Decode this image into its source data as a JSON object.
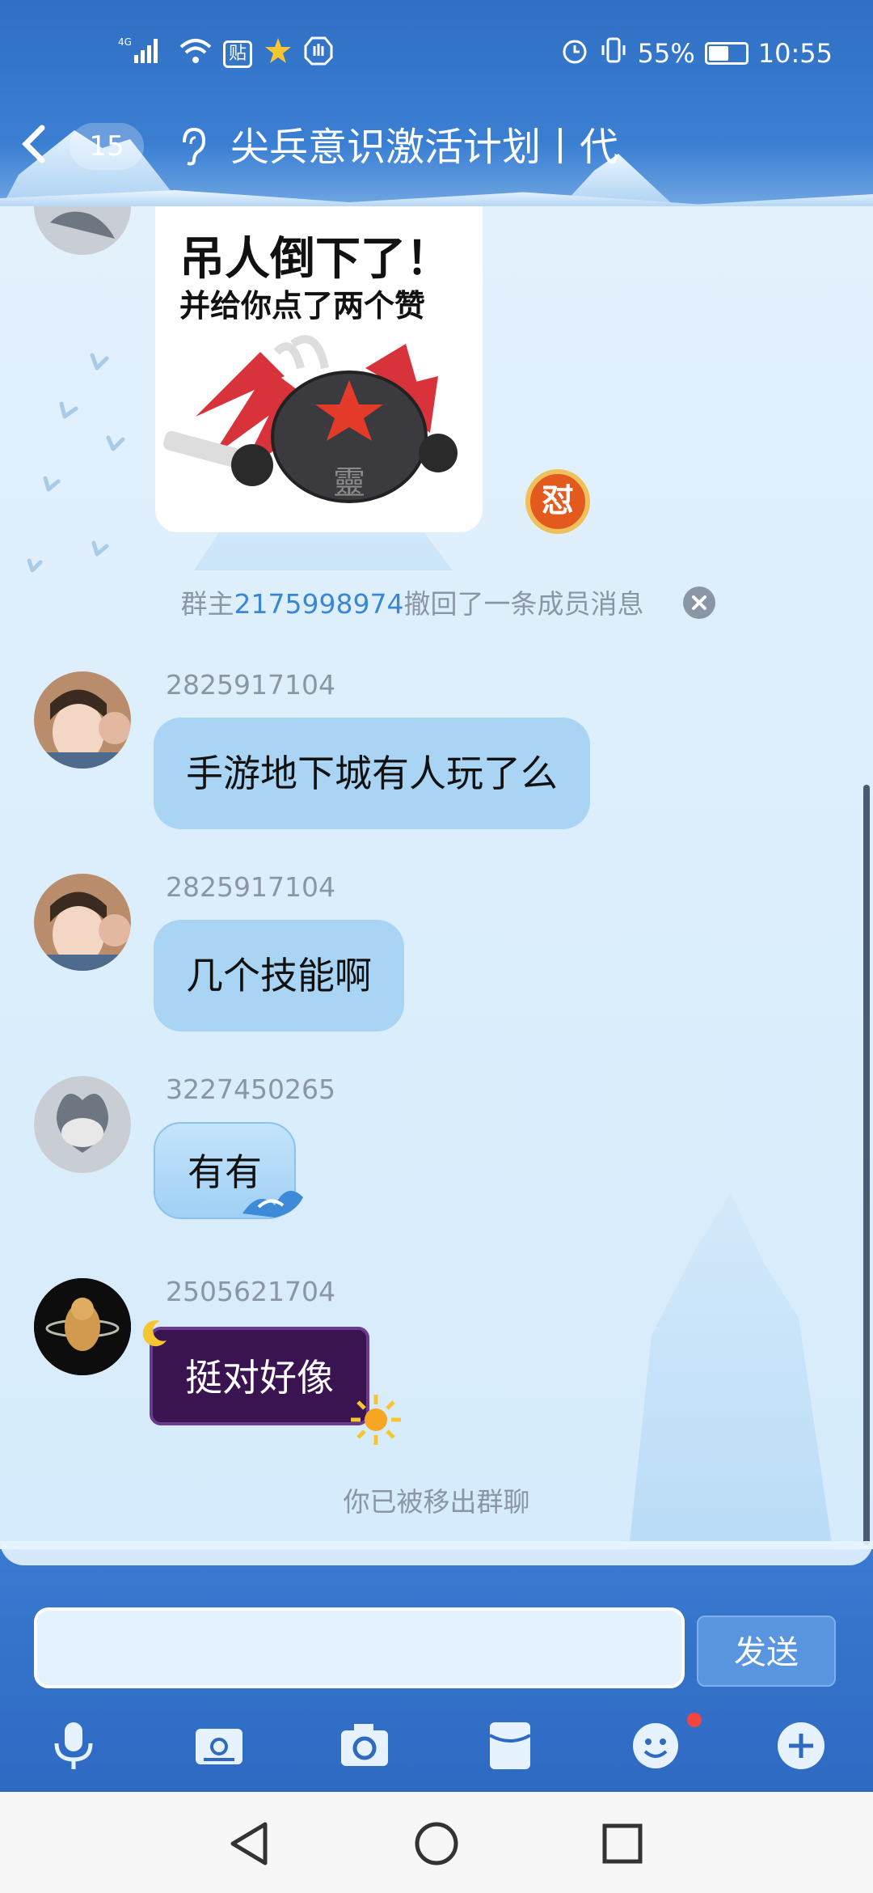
{
  "status_bar": {
    "network": "4G",
    "sticker_app": "贴",
    "battery_percent": "55%",
    "battery_level": 0.55,
    "time": "10:55"
  },
  "header": {
    "back_icon": "chevron-left-icon",
    "unread_count": "15",
    "mode_icon": "ear-icon",
    "title": "尖兵意识激活计划丨代"
  },
  "sticker": {
    "line1": "吊人倒下了！",
    "line2": "并给你点了两个赞",
    "badge_char": "怼",
    "hat_char": "靈"
  },
  "system_messages": {
    "recall_prefix": "群主",
    "recall_user": "2175998974",
    "recall_suffix": "撤回了一条成员消息",
    "removed": "你已被移出群聊"
  },
  "messages": [
    {
      "sender": "2825917104",
      "text": "手游地下城有人玩了么"
    },
    {
      "sender": "2825917104",
      "text": "几个技能啊"
    },
    {
      "sender": "3227450265",
      "text": "有有"
    },
    {
      "sender": "2505621704",
      "text": "挺对好像"
    }
  ],
  "input": {
    "placeholder": "",
    "send_label": "发送"
  },
  "toolbar": [
    "microphone-icon",
    "image-icon",
    "camera-icon",
    "red-packet-icon",
    "emoji-icon",
    "plus-icon"
  ],
  "colors": {
    "header_blue": "#2f6fc4",
    "bubble_blue": "#aad4f4",
    "link_blue": "#3a86d6",
    "purple_bubble": "#3a1450"
  }
}
